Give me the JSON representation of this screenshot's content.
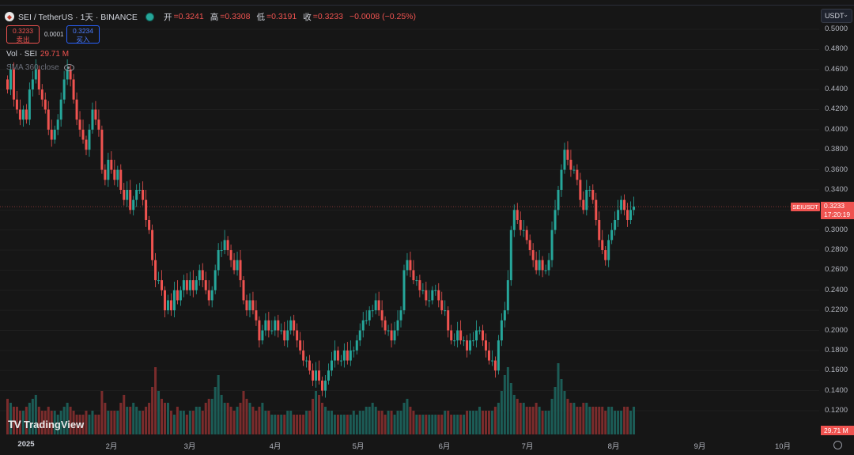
{
  "header": {
    "symbol_title": "SEI / TetherUS · 1天 · BINANCE",
    "open_label": "开",
    "open": "=0.3241",
    "high_label": "高",
    "high": "=0.3308",
    "low_label": "低",
    "low": "=0.3191",
    "close_label": "收",
    "close": "=0.3233",
    "change": "−0.0008 (−0.25%)"
  },
  "trade": {
    "sell_price": "0.3233",
    "sell_label": "卖出",
    "spread": "0.0001",
    "buy_price": "0.3234",
    "buy_label": "买入"
  },
  "indicators": {
    "vol_label": "Vol · SEI",
    "vol_value": "29.71 M",
    "sma_label": "SMA 360 close"
  },
  "price_axis": {
    "currency": "USDT",
    "ticks": [
      "0.5000",
      "0.4800",
      "0.4600",
      "0.4400",
      "0.4200",
      "0.4000",
      "0.3800",
      "0.3600",
      "0.3400",
      "0.3200",
      "0.3000",
      "0.2800",
      "0.2600",
      "0.2400",
      "0.2200",
      "0.2000",
      "0.1800",
      "0.1600",
      "0.1400",
      "0.1200"
    ],
    "symbol_badge": "SEIUSDT",
    "last_price": "0.3233",
    "countdown": "17:20:19",
    "volume_badge": "29.71 M"
  },
  "time_axis": {
    "labels": [
      "2025",
      "2月",
      "3月",
      "4月",
      "5月",
      "6月",
      "7月",
      "8月",
      "9月",
      "10月"
    ]
  },
  "logo_text": "TradingView",
  "colors": {
    "up": "#26a69a",
    "down": "#ef5350",
    "background": "#161616"
  },
  "chart_data": {
    "type": "candlestick",
    "interval": "1D",
    "y_range": [
      0.1,
      0.51
    ],
    "x_start": "2025-01-01",
    "series": [
      {
        "name": "SEI/USDT",
        "closes": [
          0.44,
          0.46,
          0.43,
          0.42,
          0.41,
          0.42,
          0.41,
          0.44,
          0.45,
          0.46,
          0.44,
          0.43,
          0.42,
          0.4,
          0.39,
          0.4,
          0.41,
          0.43,
          0.45,
          0.46,
          0.45,
          0.43,
          0.41,
          0.4,
          0.39,
          0.38,
          0.4,
          0.42,
          0.41,
          0.4,
          0.36,
          0.35,
          0.37,
          0.36,
          0.35,
          0.36,
          0.34,
          0.33,
          0.34,
          0.32,
          0.33,
          0.34,
          0.34,
          0.33,
          0.31,
          0.3,
          0.27,
          0.25,
          0.25,
          0.24,
          0.22,
          0.23,
          0.22,
          0.24,
          0.23,
          0.24,
          0.25,
          0.24,
          0.25,
          0.24,
          0.25,
          0.26,
          0.25,
          0.24,
          0.23,
          0.24,
          0.26,
          0.28,
          0.28,
          0.29,
          0.28,
          0.27,
          0.26,
          0.27,
          0.25,
          0.23,
          0.22,
          0.23,
          0.22,
          0.21,
          0.19,
          0.2,
          0.21,
          0.2,
          0.2,
          0.21,
          0.2,
          0.2,
          0.19,
          0.2,
          0.21,
          0.2,
          0.19,
          0.18,
          0.17,
          0.17,
          0.16,
          0.15,
          0.16,
          0.15,
          0.14,
          0.15,
          0.16,
          0.17,
          0.18,
          0.17,
          0.17,
          0.18,
          0.17,
          0.18,
          0.18,
          0.19,
          0.2,
          0.21,
          0.21,
          0.22,
          0.22,
          0.23,
          0.22,
          0.21,
          0.2,
          0.2,
          0.19,
          0.2,
          0.21,
          0.22,
          0.26,
          0.27,
          0.26,
          0.25,
          0.25,
          0.24,
          0.24,
          0.23,
          0.23,
          0.24,
          0.24,
          0.23,
          0.22,
          0.22,
          0.2,
          0.19,
          0.19,
          0.2,
          0.19,
          0.19,
          0.18,
          0.19,
          0.19,
          0.2,
          0.2,
          0.19,
          0.18,
          0.17,
          0.17,
          0.16,
          0.19,
          0.21,
          0.22,
          0.25,
          0.3,
          0.32,
          0.31,
          0.3,
          0.3,
          0.29,
          0.28,
          0.27,
          0.26,
          0.27,
          0.26,
          0.26,
          0.27,
          0.3,
          0.32,
          0.34,
          0.36,
          0.38,
          0.37,
          0.36,
          0.36,
          0.35,
          0.33,
          0.32,
          0.34,
          0.34,
          0.33,
          0.31,
          0.29,
          0.28,
          0.27,
          0.29,
          0.3,
          0.31,
          0.32,
          0.33,
          0.32,
          0.31,
          0.32,
          0.3233
        ]
      },
      {
        "name": "Vol · SEI",
        "volume_m": [
          45,
          40,
          35,
          35,
          30,
          30,
          35,
          40,
          45,
          50,
          35,
          30,
          30,
          35,
          30,
          30,
          25,
          30,
          35,
          40,
          35,
          30,
          25,
          25,
          25,
          30,
          25,
          30,
          25,
          25,
          55,
          40,
          30,
          30,
          30,
          30,
          40,
          50,
          35,
          35,
          40,
          35,
          30,
          30,
          35,
          40,
          60,
          85,
          55,
          45,
          40,
          40,
          30,
          25,
          35,
          30,
          30,
          25,
          30,
          30,
          35,
          35,
          30,
          40,
          45,
          45,
          60,
          75,
          50,
          40,
          40,
          35,
          30,
          35,
          40,
          55,
          45,
          40,
          35,
          30,
          35,
          40,
          30,
          30,
          25,
          25,
          25,
          25,
          25,
          30,
          30,
          25,
          25,
          25,
          25,
          30,
          30,
          45,
          55,
          50,
          40,
          35,
          30,
          30,
          25,
          25,
          25,
          25,
          25,
          25,
          30,
          25,
          30,
          30,
          35,
          35,
          40,
          35,
          30,
          30,
          25,
          30,
          30,
          25,
          30,
          30,
          40,
          45,
          35,
          30,
          25,
          25,
          25,
          25,
          25,
          25,
          25,
          25,
          25,
          30,
          30,
          25,
          25,
          25,
          25,
          25,
          30,
          30,
          30,
          30,
          35,
          30,
          30,
          30,
          30,
          35,
          40,
          55,
          75,
          85,
          65,
          50,
          45,
          40,
          40,
          35,
          35,
          35,
          40,
          35,
          30,
          30,
          30,
          45,
          60,
          90,
          70,
          55,
          45,
          40,
          40,
          35,
          35,
          40,
          40,
          35,
          35,
          35,
          35,
          35,
          30,
          35,
          35,
          30,
          30,
          30,
          35,
          35,
          30,
          35,
          35,
          29.71
        ]
      }
    ]
  }
}
